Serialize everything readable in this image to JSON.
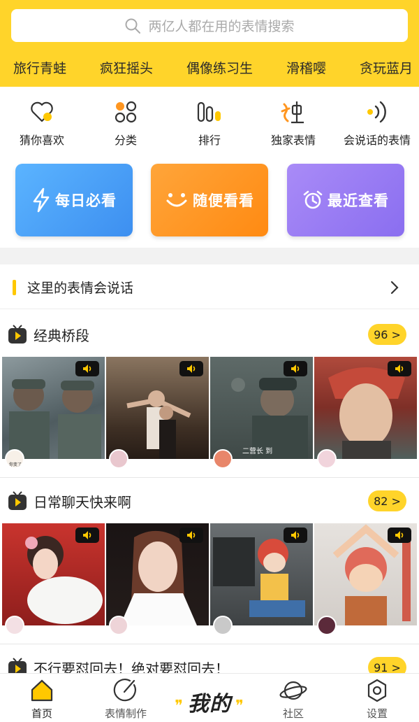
{
  "search": {
    "placeholder": "两亿人都在用的表情搜索"
  },
  "hot_tags": [
    "旅行青蛙",
    "疯狂摇头",
    "偶像练习生",
    "滑稽嘤",
    "贪玩蓝月"
  ],
  "quick_entries": [
    {
      "label": "猜你喜欢",
      "icon": "heart-icon"
    },
    {
      "label": "分类",
      "icon": "category-icon"
    },
    {
      "label": "排行",
      "icon": "ranking-icon"
    },
    {
      "label": "独家表情",
      "icon": "exclusive-icon"
    },
    {
      "label": "会说话的表情",
      "icon": "sound-icon"
    }
  ],
  "feature_cards": [
    {
      "label": "每日必看",
      "icon": "lightning-icon",
      "color": "#4aa3f5"
    },
    {
      "label": "随便看看",
      "icon": "smile-icon",
      "color": "#ff9620"
    },
    {
      "label": "最近查看",
      "icon": "alarm-icon",
      "color": "#9b7bf2"
    }
  ],
  "talking_banner": {
    "title": "这里的表情会说话"
  },
  "sections": [
    {
      "title": "经典桥段",
      "count": "96 >"
    },
    {
      "title": "日常聊天快来啊",
      "count": "82 >"
    },
    {
      "title": "不行要怼回去！绝对要怼回去！",
      "count": "91 >"
    }
  ],
  "thumb_captions": {
    "s1_0": "你变了",
    "s1_2": "二营长 到"
  },
  "tabs": [
    {
      "label": "首页",
      "icon": "home-icon"
    },
    {
      "label": "表情制作",
      "icon": "make-icon"
    },
    {
      "label": "我的",
      "icon": ""
    },
    {
      "label": "社区",
      "icon": "planet-icon"
    },
    {
      "label": "设置",
      "icon": "settings-icon"
    }
  ],
  "colors": {
    "brand_yellow": "#ffd42a",
    "accent_yellow": "#ffc800"
  }
}
